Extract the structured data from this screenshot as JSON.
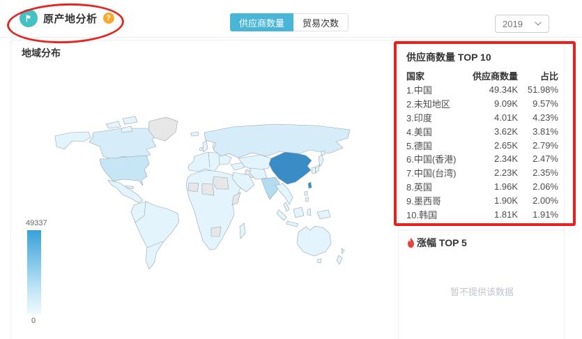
{
  "header": {
    "title": "原产地分析",
    "help_label": "?",
    "tabs": [
      {
        "label": "供应商数量",
        "active": true
      },
      {
        "label": "贸易次数",
        "active": false
      }
    ],
    "year": "2019"
  },
  "map_panel": {
    "title": "地域分布",
    "legend_max": "49337",
    "legend_min": "0"
  },
  "top10": {
    "title": "供应商数量 TOP 10",
    "col_country": "国家",
    "col_count": "供应商数量",
    "col_pct": "占比",
    "rows": [
      {
        "country": "1.中国",
        "count": "49.34K",
        "pct": "51.98%"
      },
      {
        "country": "2.未知地区",
        "count": "9.09K",
        "pct": "9.57%"
      },
      {
        "country": "3.印度",
        "count": "4.01K",
        "pct": "4.23%"
      },
      {
        "country": "4.美国",
        "count": "3.62K",
        "pct": "3.81%"
      },
      {
        "country": "5.德国",
        "count": "2.65K",
        "pct": "2.79%"
      },
      {
        "country": "6.中国(香港)",
        "count": "2.34K",
        "pct": "2.47%"
      },
      {
        "country": "7.中国(台湾)",
        "count": "2.23K",
        "pct": "2.35%"
      },
      {
        "country": "8.英国",
        "count": "1.96K",
        "pct": "2.06%"
      },
      {
        "country": "9.墨西哥",
        "count": "1.90K",
        "pct": "2.00%"
      },
      {
        "country": "10.韩国",
        "count": "1.81K",
        "pct": "1.91%"
      }
    ]
  },
  "rise_panel": {
    "title": "涨幅 TOP 5",
    "empty_text": "暂不提供该数据"
  },
  "colors": {
    "app_icon_teal": "#45c0c5",
    "help_orange": "#f7a92c",
    "tab_active_blue": "#49b6d8",
    "annotation_red": "#e8211d",
    "china_blue": "#3a8cc7",
    "map_pale_blue": "#e3f4fc",
    "map_no_data_gray": "#e7e7e7",
    "legend_top_blue": "#38a1d9",
    "flame_red": "#e8433a"
  },
  "chart_data": {
    "type": "heatmap",
    "subtype": "world-choropleth",
    "title": "地域分布",
    "legend_range": [
      0,
      49337
    ],
    "series": [
      {
        "name": "中国",
        "value": 49340
      },
      {
        "name": "未知地区",
        "value": 9090
      },
      {
        "name": "印度",
        "value": 4010
      },
      {
        "name": "美国",
        "value": 3620
      },
      {
        "name": "德国",
        "value": 2650
      },
      {
        "name": "中国(香港)",
        "value": 2340
      },
      {
        "name": "中国(台湾)",
        "value": 2230
      },
      {
        "name": "英国",
        "value": 1960
      },
      {
        "name": "墨西哥",
        "value": 1900
      },
      {
        "name": "韩国",
        "value": 1810
      }
    ]
  }
}
